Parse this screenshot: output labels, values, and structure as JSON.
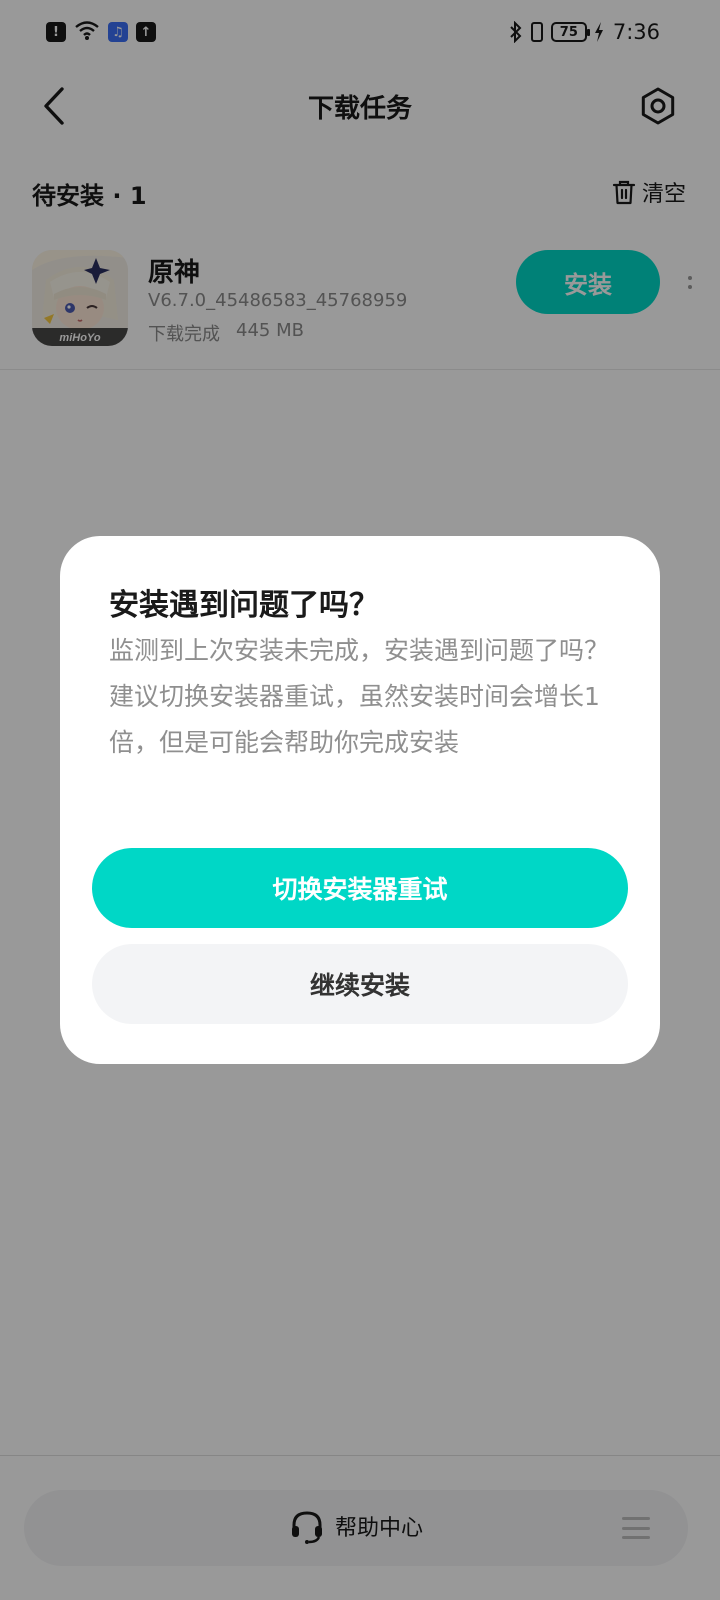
{
  "status_bar": {
    "time": "7:36",
    "battery": "75",
    "left_icons": [
      "alert-icon",
      "wifi-icon",
      "music-app-icon",
      "upload-icon"
    ],
    "right_icons": [
      "bluetooth-icon",
      "vibrate-icon",
      "battery-icon",
      "charging-icon"
    ]
  },
  "header": {
    "title": "下载任务",
    "back_icon": "chevron-left-icon",
    "settings_icon": "gear-icon"
  },
  "section": {
    "title": "待安装 · 1",
    "clear_label": "清空",
    "clear_icon": "trash-icon"
  },
  "app": {
    "name": "原神",
    "version": "V6.7.0_45486583_45768959",
    "status": "下载完成",
    "size": "445 MB",
    "install_label": "安装",
    "icon_caption": "miHoYo"
  },
  "bottom": {
    "help_label": "帮助中心",
    "help_icon": "headset-icon",
    "menu_icon": "menu-icon"
  },
  "dialog": {
    "title": "安装遇到问题了吗？",
    "message_line1": "监测到上次安装未完成，安装遇到问题了吗？",
    "message_line2": "建议切换安装器重试，虽然安装时间会增长1倍，但是可能会帮助你完成安装",
    "primary_label": "切换安装器重试",
    "secondary_label": "继续安装"
  },
  "colors": {
    "accent": "#00d7c6",
    "scrim": "rgba(0,0,0,0.40)",
    "secondary_button_bg": "#f3f4f6",
    "muted_text": "#8f8f8f"
  }
}
